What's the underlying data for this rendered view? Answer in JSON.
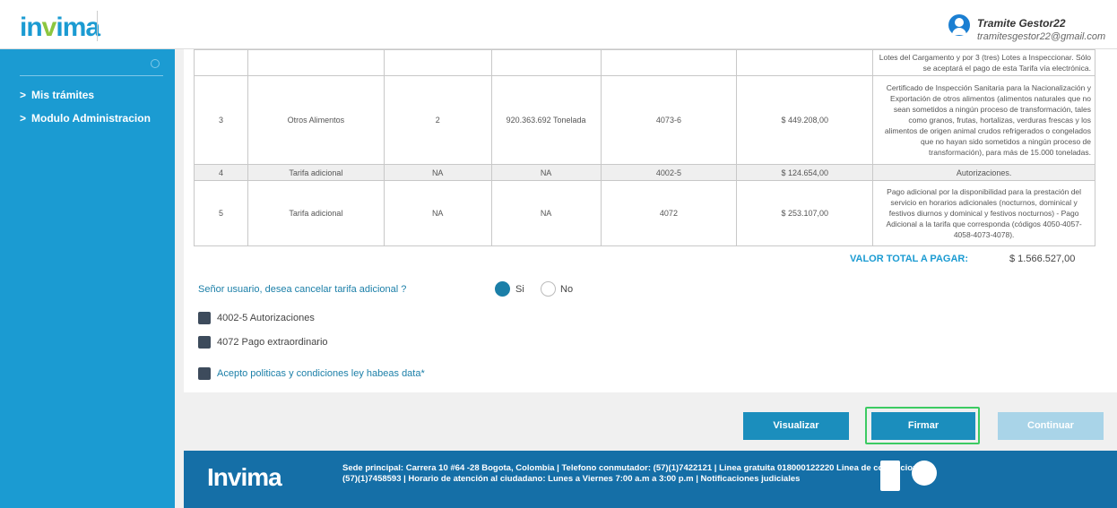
{
  "header": {
    "logo": {
      "pre": "in",
      "v": "v",
      "post": "ima"
    },
    "user_name": "Tramite Gestor22",
    "user_email": "tramitesgestor22@gmail.com"
  },
  "sidebar": {
    "items": [
      {
        "label": "Mis trámites"
      },
      {
        "label": "Modulo Administracion"
      }
    ]
  },
  "table": {
    "rows": [
      {
        "num": "",
        "concept": "",
        "qty": "",
        "amount": "",
        "code": "",
        "value": "",
        "desc": "Lotes del Cargamento y por 3 (tres) Lotes a Inspeccionar. Sólo se aceptará el pago de esta Tarifa vía electrónica."
      },
      {
        "num": "3",
        "concept": "Otros Alimentos",
        "qty": "2",
        "amount": "920.363.692 Tonelada",
        "code": "4073-6",
        "value": "$ 449.208,00",
        "desc": "Certificado de Inspección Sanitaria para la Nacionalización y Exportación de otros alimentos (alimentos naturales que no sean sometidos a ningún proceso de transformación, tales como granos, frutas, hortalizas, verduras frescas y los alimentos de origen animal crudos refrigerados o congelados que no hayan sido sometidos a ningún proceso de transformación), para más de 15.000 toneladas."
      },
      {
        "num": "4",
        "concept": "Tarifa adicional",
        "qty": "NA",
        "amount": "NA",
        "code": "4002-5",
        "value": "$ 124.654,00",
        "desc": "Autorizaciones."
      },
      {
        "num": "5",
        "concept": "Tarifa adicional",
        "qty": "NA",
        "amount": "NA",
        "code": "4072",
        "value": "$ 253.107,00",
        "desc": "Pago adicional por la disponibilidad para la prestación del servicio en horarios adicionales (nocturnos, dominical y festivos diurnos y dominical y festivos nocturnos) - Pago Adicional a la tarifa que corresponda (códigos 4050-4057-4058-4073-4078)."
      }
    ]
  },
  "total": {
    "label": "VALOR TOTAL A PAGAR:",
    "value": "$ 1.566.527,00"
  },
  "question": {
    "text": "Señor usuario, desea cancelar tarifa adicional ?",
    "yes_label": "Si",
    "no_label": "No",
    "selected": "Si"
  },
  "checkboxes": [
    {
      "label": "4002-5 Autorizaciones"
    },
    {
      "label": "4072 Pago extraordinario"
    },
    {
      "label": "Acepto politicas y condiciones ley habeas data*"
    }
  ],
  "buttons": {
    "visualizar": "Visualizar",
    "firmar": "Firmar",
    "continuar": "Continuar"
  },
  "footer": {
    "logo": "Invima",
    "text": "Sede principal: Carrera 10 #64 -28 Bogota, Colombia | Telefono conmutador: (57)(1)7422121 | Linea gratuita 018000122220 Linea de corrupcion (57)(1)7458593 | Horario de atención al ciudadano: Lunes a Viernes 7:00 a.m a 3:00 p.m | Notificaciones judiciales"
  },
  "colors": {
    "primary": "#1b9bd2",
    "footer": "#156fa7",
    "highlight": "#3ccb62"
  }
}
